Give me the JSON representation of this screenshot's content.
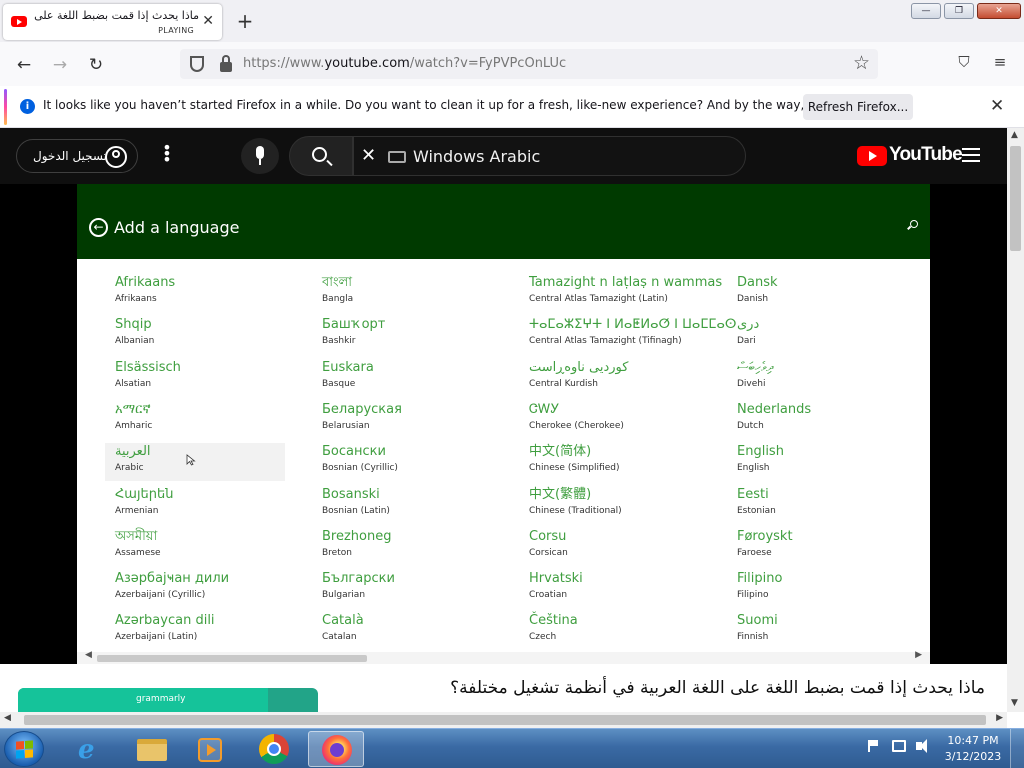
{
  "browser": {
    "tab": {
      "title": "ماذا يحدث إذا قمت بضبط اللغة على ا",
      "status": "PLAYING",
      "close": "✕"
    },
    "new_tab": "+",
    "window_controls": {
      "minimize": "—",
      "restore": "❐",
      "close": "✕"
    },
    "nav": {
      "back": "←",
      "forward": "→",
      "reload": "↻"
    },
    "url": {
      "prefix": "https://www.",
      "host": "youtube.com",
      "path": "/watch?v=FyPVPcOnLUc"
    },
    "star": "☆",
    "pocket": "⛉",
    "menu": "≡"
  },
  "notification": {
    "info_icon": "i",
    "message": "It looks like you haven’t started Firefox in a while. Do you want to clean it up for a fresh, like-new experience? And by the way, welcome back!",
    "button": "Refresh Firefox...",
    "close": "✕"
  },
  "youtube": {
    "sign_in": "تسجيل الدخول",
    "more": "⋮",
    "search_query": "Windows Arabic",
    "clear": "✕",
    "logo_text": "YouTube"
  },
  "video": {
    "panel_title": "Add a language",
    "back_icon": "←",
    "languages": [
      [
        {
          "name": "Afrikaans",
          "sub": "Afrikaans"
        },
        {
          "name": "Shqip",
          "sub": "Albanian"
        },
        {
          "name": "Elsässisch",
          "sub": "Alsatian"
        },
        {
          "name": "አማርኛ",
          "sub": "Amharic"
        },
        {
          "name": "العربية",
          "sub": "Arabic"
        },
        {
          "name": "Հայերեն",
          "sub": "Armenian"
        },
        {
          "name": "অসমীয়া",
          "sub": "Assamese"
        },
        {
          "name": "Азәрбајҹан дили",
          "sub": "Azerbaijani (Cyrillic)"
        },
        {
          "name": "Azərbaycan dili",
          "sub": "Azerbaijani (Latin)"
        }
      ],
      [
        {
          "name": "বাংলা",
          "sub": "Bangla"
        },
        {
          "name": "Башҡорт",
          "sub": "Bashkir"
        },
        {
          "name": "Euskara",
          "sub": "Basque"
        },
        {
          "name": "Беларуская",
          "sub": "Belarusian"
        },
        {
          "name": "Босански",
          "sub": "Bosnian (Cyrillic)"
        },
        {
          "name": "Bosanski",
          "sub": "Bosnian (Latin)"
        },
        {
          "name": "Brezhoneg",
          "sub": "Breton"
        },
        {
          "name": "Български",
          "sub": "Bulgarian"
        },
        {
          "name": "Català",
          "sub": "Catalan"
        }
      ],
      [
        {
          "name": "Tamazight n laṭlaṣ n wammas",
          "sub": "Central Atlas Tamazight (Latin)"
        },
        {
          "name": "ⵜⴰⵎⴰⵣⵉⵖⵜ ⵏ ⵍⴰⵟⵍⴰⵚ ⵏ ⵡⴰⵎⵎⴰⵙ",
          "sub": "Central Atlas Tamazight (Tifinagh)"
        },
        {
          "name": "کوردیی ناوەڕاست",
          "sub": "Central Kurdish"
        },
        {
          "name": "ᏣᎳᎩ",
          "sub": "Cherokee (Cherokee)"
        },
        {
          "name": "中文(简体)",
          "sub": "Chinese (Simplified)"
        },
        {
          "name": "中文(繁體)",
          "sub": "Chinese (Traditional)"
        },
        {
          "name": "Corsu",
          "sub": "Corsican"
        },
        {
          "name": "Hrvatski",
          "sub": "Croatian"
        },
        {
          "name": "Čeština",
          "sub": "Czech"
        }
      ],
      [
        {
          "name": "Dansk",
          "sub": "Danish"
        },
        {
          "name": "دری",
          "sub": "Dari"
        },
        {
          "name": "ދިވެހިބަސް",
          "sub": "Divehi"
        },
        {
          "name": "Nederlands",
          "sub": "Dutch"
        },
        {
          "name": "English",
          "sub": "English"
        },
        {
          "name": "Eesti",
          "sub": "Estonian"
        },
        {
          "name": "Føroyskt",
          "sub": "Faroese"
        },
        {
          "name": "Filipino",
          "sub": "Filipino"
        },
        {
          "name": "Suomi",
          "sub": "Finnish"
        }
      ]
    ],
    "hovered_language": "Arabic"
  },
  "page": {
    "video_title": "ماذا يحدث إذا قمت بضبط اللغة على اللغة العربية في أنظمة تشغيل مختلفة؟",
    "ad_label": "grammarly"
  },
  "taskbar": {
    "time": "10:47 PM",
    "date": "3/12/2023",
    "ie_glyph": "e"
  },
  "colors": {
    "youtube_red": "#ff0000",
    "panel_green": "#003a00",
    "language_green": "#3f9e3f",
    "firefox_accent": "#0060df"
  }
}
